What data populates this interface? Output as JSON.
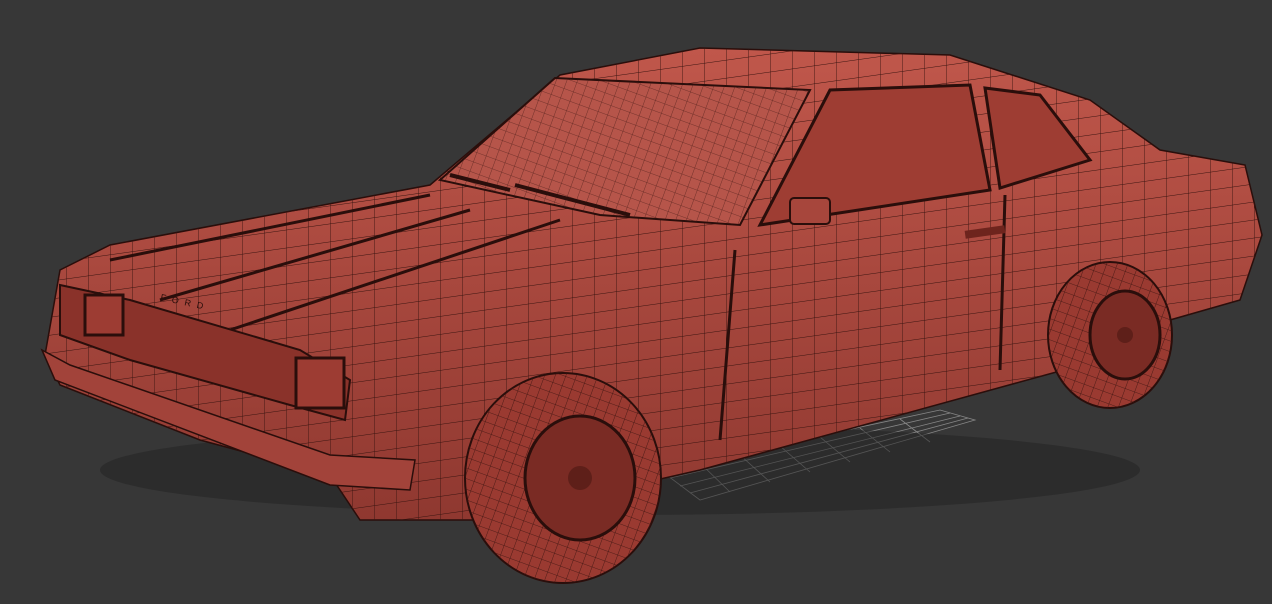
{
  "viewport": {
    "background_color": "#373737",
    "model_color": "#b04a3f",
    "wire_color": "#3a1410",
    "grid_color": "#9a9a9a",
    "hood_lettering": "FORD"
  }
}
